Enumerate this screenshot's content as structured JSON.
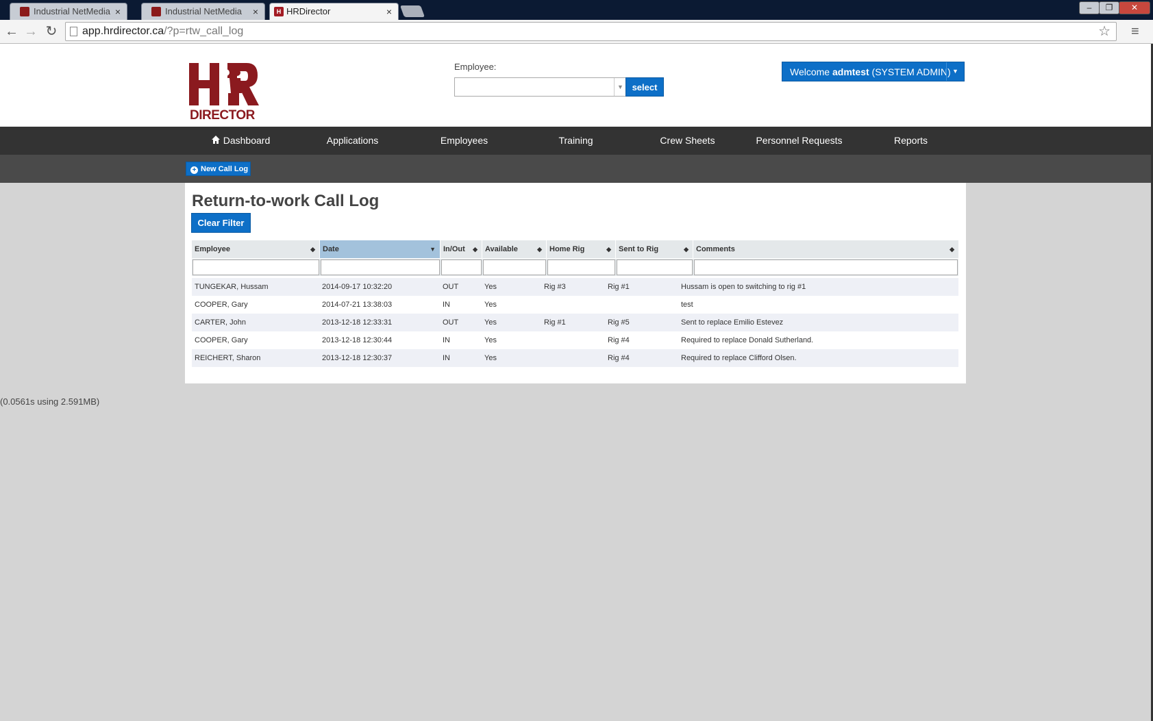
{
  "browser": {
    "tabs": [
      {
        "title": "Industrial NetMedia"
      },
      {
        "title": "Industrial NetMedia"
      },
      {
        "title": "HRDirector"
      }
    ],
    "url_host": "app.hrdirector.ca",
    "url_path": "/?p=rtw_call_log"
  },
  "header": {
    "logo_text": "HR DIRECTOR",
    "employee_label": "Employee:",
    "employee_value": "",
    "select_label": "select",
    "welcome_prefix": "Welcome ",
    "welcome_user": "admtest",
    "welcome_role": " (SYSTEM ADMIN)"
  },
  "nav": {
    "items": [
      {
        "label": "Dashboard",
        "icon": "home-icon"
      },
      {
        "label": "Applications"
      },
      {
        "label": "Employees"
      },
      {
        "label": "Training"
      },
      {
        "label": "Crew Sheets"
      },
      {
        "label": "Personnel Requests"
      },
      {
        "label": "Reports"
      }
    ]
  },
  "subnav": {
    "new_call_log": "New Call Log"
  },
  "main": {
    "title": "Return-to-work Call Log",
    "clear_filter": "Clear Filter",
    "columns": [
      "Employee",
      "Date",
      "In/Out",
      "Available",
      "Home Rig",
      "Sent to Rig",
      "Comments"
    ],
    "sorted_column": "Date",
    "rows": [
      {
        "employee": "TUNGEKAR, Hussam",
        "date": "2014-09-17 10:32:20",
        "inout": "OUT",
        "available": "Yes",
        "home_rig": "Rig #3",
        "sent_rig": "Rig #1",
        "comments": "Hussam is open to switching to rig #1"
      },
      {
        "employee": "COOPER, Gary",
        "date": "2014-07-21 13:38:03",
        "inout": "IN",
        "available": "Yes",
        "home_rig": "",
        "sent_rig": "",
        "comments": "test"
      },
      {
        "employee": "CARTER, John",
        "date": "2013-12-18 12:33:31",
        "inout": "OUT",
        "available": "Yes",
        "home_rig": "Rig #1",
        "sent_rig": "Rig #5",
        "comments": "Sent to replace Emilio Estevez"
      },
      {
        "employee": "COOPER, Gary",
        "date": "2013-12-18 12:30:44",
        "inout": "IN",
        "available": "Yes",
        "home_rig": "",
        "sent_rig": "Rig #4",
        "comments": "Required to replace Donald Sutherland."
      },
      {
        "employee": "REICHERT, Sharon",
        "date": "2013-12-18 12:30:37",
        "inout": "IN",
        "available": "Yes",
        "home_rig": "",
        "sent_rig": "Rig #4",
        "comments": "Required to replace Clifford Olsen."
      }
    ]
  },
  "footer": {
    "timing": "(0.0561s using 2.591MB)"
  },
  "colors": {
    "brand_red": "#8b1a1f",
    "accent_blue": "#0d6fc7",
    "nav_bg": "#333333"
  }
}
